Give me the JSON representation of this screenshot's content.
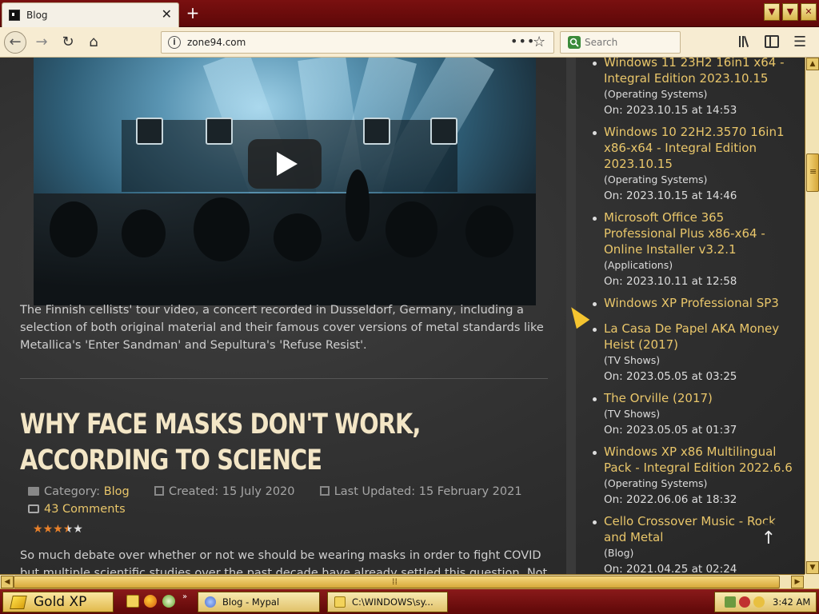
{
  "browser": {
    "tab_title": "Blog",
    "url": "zone94.com",
    "search_placeholder": "Search"
  },
  "main": {
    "paragraph": "The Finnish cellists' tour video, a concert recorded in Dusseldorf, Germany, including a selection of both original material and their famous cover versions of metal standards like Metallica's 'Enter Sandman' and Sepultura's 'Refuse Resist'.",
    "article": {
      "title": "WHY FACE MASKS DON'T WORK, ACCORDING TO SCIENCE",
      "category_label": "Category:",
      "category": "Blog",
      "created": "Created: 15 July 2020",
      "updated": "Last Updated: 15 February 2021",
      "comments": "43 Comments",
      "rating": 3.5,
      "excerpt": "So much debate over whether or not we should be wearing masks in order to fight COVID but multiple scientific studies over the past decade have already settled this question. Not only do"
    }
  },
  "sidebar": {
    "items": [
      {
        "title": "Windows 11 23H2 16in1 x64 - Integral Edition 2023.10.15",
        "category": "(Operating Systems)",
        "date": "On: 2023.10.15 at 14:53"
      },
      {
        "title": "Windows 10 22H2.3570 16in1 x86-x64 - Integral Edition 2023.10.15",
        "category": "(Operating Systems)",
        "date": "On: 2023.10.15 at 14:46"
      },
      {
        "title": "Microsoft Office 365 Professional Plus x86-x64 - Online Installer v3.2.1",
        "category": "(Applications)",
        "date": "On: 2023.10.11 at 12:58"
      },
      {
        "title": "Windows XP Professional SP3",
        "category": "",
        "date": ""
      },
      {
        "title": "La Casa De Papel AKA Money Heist (2017)",
        "category": "(TV Shows)",
        "date": "On: 2023.05.05 at 03:25"
      },
      {
        "title": "The Orville (2017)",
        "category": "(TV Shows)",
        "date": "On: 2023.05.05 at 01:37"
      },
      {
        "title": "Windows XP x86 Multilingual Pack - Integral Edition 2022.6.6",
        "category": "(Operating Systems)",
        "date": "On: 2022.06.06 at 18:32"
      },
      {
        "title": "Cello Crossover Music - Rock and Metal",
        "category": "(Blog)",
        "date": "On: 2021.04.25 at 02:24"
      }
    ]
  },
  "taskbar": {
    "start_label": "Gold XP",
    "tasks": [
      "Blog - Mypal",
      "C:\\WINDOWS\\sy..."
    ],
    "clock": "3:42 AM",
    "more": "»"
  },
  "colors": {
    "accent": "#e9c66a",
    "title": "#f3e6c6",
    "chrome": "#6e0c0c"
  }
}
